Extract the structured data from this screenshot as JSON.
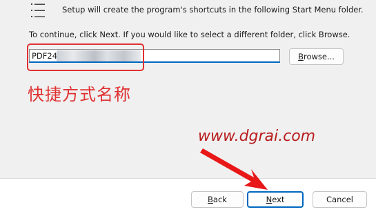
{
  "setup": {
    "description": "Setup will create the program's shortcuts in the following Start Menu folder.",
    "instruction": "To continue, click Next. If you would like to select a different folder, click Browse."
  },
  "folder": {
    "value": "PDF24"
  },
  "buttons": {
    "browse_pre": "B",
    "browse_rest": "rowse...",
    "back_pre": "B",
    "back_rest": "ack",
    "next_pre": "N",
    "next_rest": "ext",
    "cancel": "Cancel"
  },
  "annotation": {
    "label": "快捷方式名称",
    "watermark": "www.dgrai.com",
    "color": "#e03030"
  },
  "colors": {
    "accent": "#0067c0",
    "watermark": "#b81d1d"
  },
  "icons": {
    "list": "list-icon",
    "arrow": "red-arrow-pointer"
  }
}
